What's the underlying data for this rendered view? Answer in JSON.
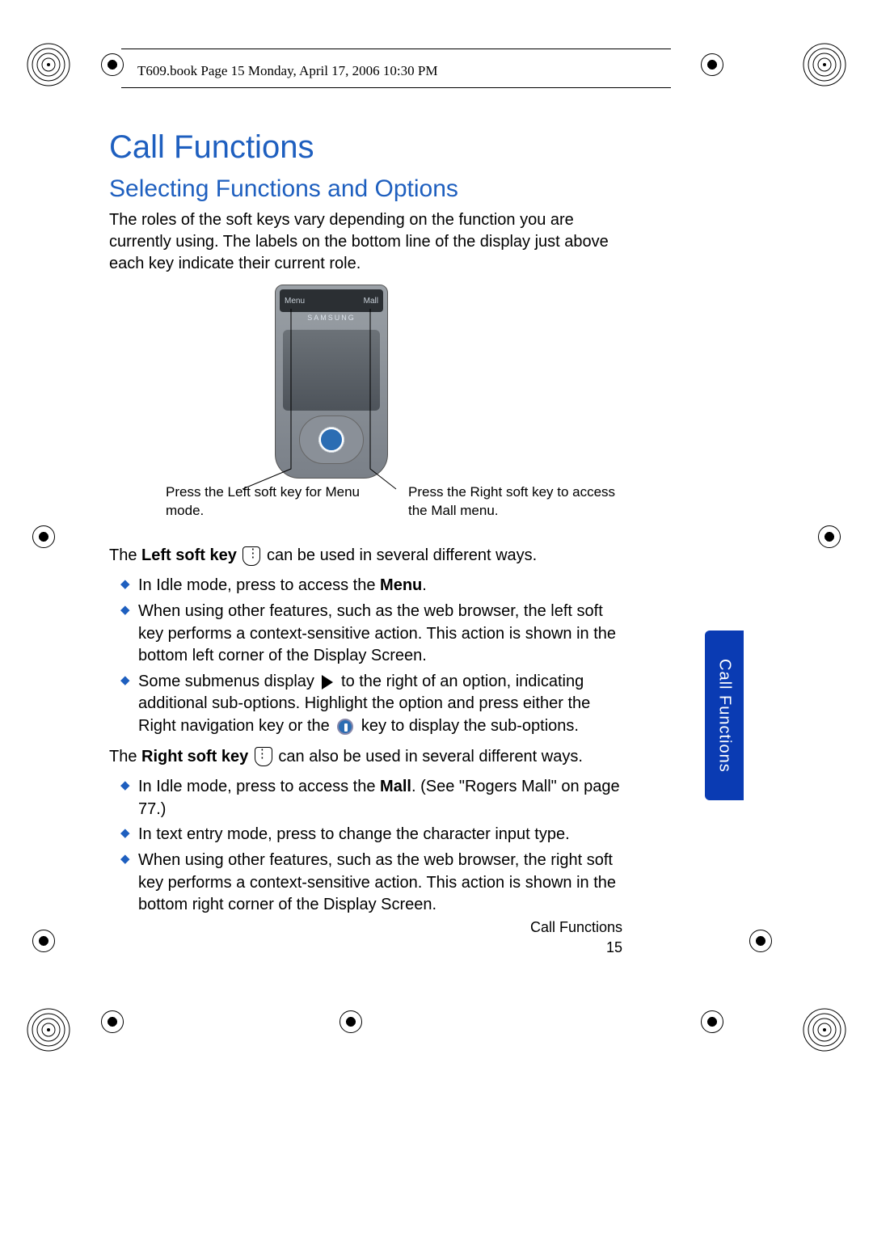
{
  "header": {
    "running_head": "T609.book  Page 15  Monday, April 17, 2006  10:30 PM"
  },
  "title": "Call Functions",
  "subtitle": "Selecting Functions and Options",
  "intro": "The roles of the soft keys vary depending on the function you are currently using. The labels on the bottom line of the display just above each key indicate their current role.",
  "phone": {
    "softkey_left_label": "Menu",
    "softkey_right_label": "Mall",
    "brand": "SAMSUNG"
  },
  "captions": {
    "left": "Press the Left soft key for Menu mode.",
    "right": "Press the Right soft key to access the Mall menu."
  },
  "left_soft_intro_a": "The ",
  "left_soft_intro_bold": "Left soft key",
  "left_soft_intro_b": " can be used in several different ways.",
  "left_bullets": {
    "b1a": "In Idle mode, press to access the ",
    "b1bold": "Menu",
    "b1b": ".",
    "b2": "When using other features, such as the web browser, the left soft key performs a context-sensitive action. This action is shown in the bottom left corner of the Display Screen.",
    "b3a": "Some submenus display ",
    "b3b": " to the right of an option, indicating additional sub-options. Highlight the option and press either the Right navigation key or the ",
    "b3c": " key to display the sub-options."
  },
  "right_soft_intro_a": "The ",
  "right_soft_intro_bold": "Right soft key",
  "right_soft_intro_b": " can also be used in several different ways.",
  "right_bullets": {
    "b1a": "In Idle mode, press to access the ",
    "b1bold": "Mall",
    "b1b": ". (See \"Rogers Mall\" on page 77.)",
    "b2": "In text entry mode, press to change the character input type.",
    "b3": "When using other features, such as the web browser, the right soft key performs a context-sensitive action. This action is shown in the bottom right corner of the Display Screen."
  },
  "side_tab": "Call Functions",
  "footer": {
    "section": "Call Functions",
    "page": "15"
  }
}
